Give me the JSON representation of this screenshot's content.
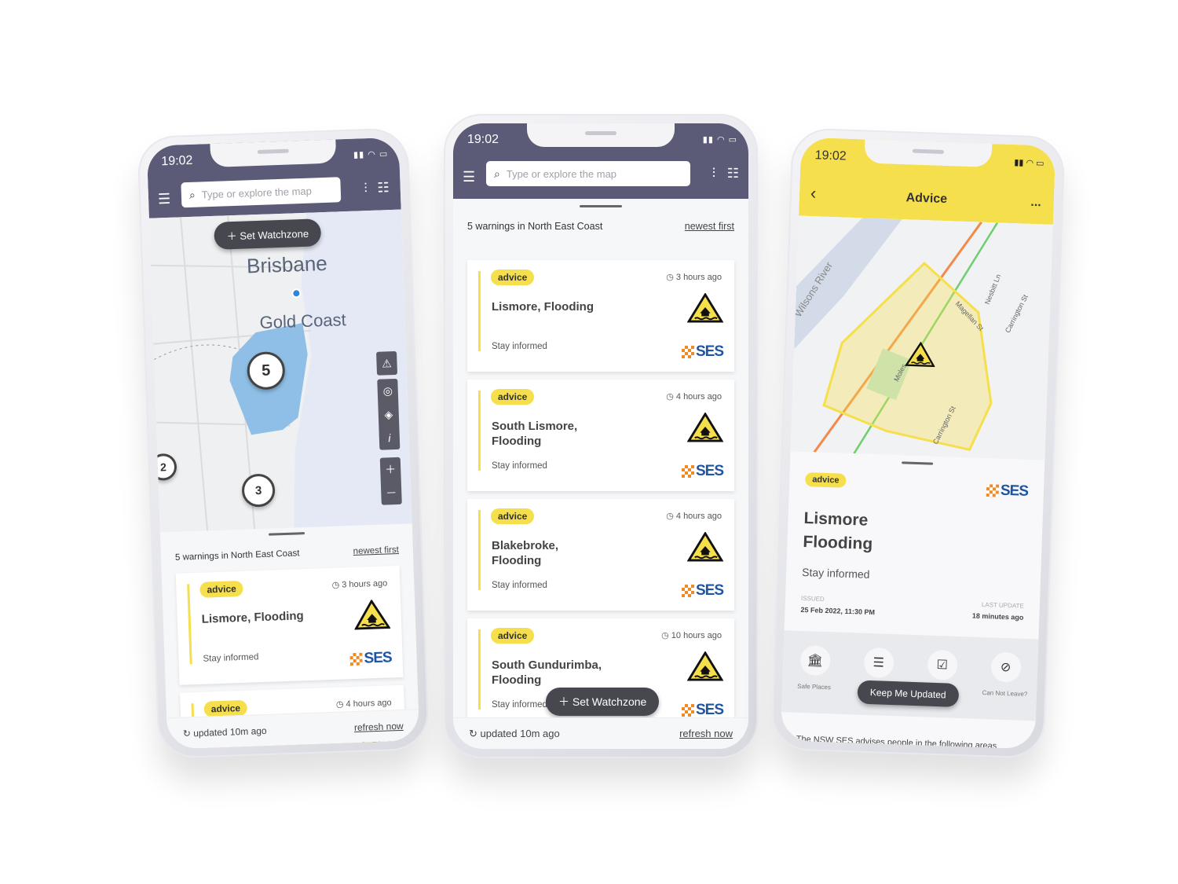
{
  "colors": {
    "header": "#5b5b78",
    "advice": "#f5df4d",
    "ses_blue": "#1e55a3",
    "ses_orange": "#f08a24",
    "warning_area": "#8fbfe6"
  },
  "status_bar": {
    "time": "19:02"
  },
  "search": {
    "placeholder": "Type or explore the map"
  },
  "icons": {
    "menu": "hamburger-icon",
    "search": "search-icon",
    "filter": "sliders-icon",
    "list": "list-icon",
    "clock": "clock-icon",
    "warning": "flood-warning-triangle-icon",
    "refresh": "refresh-icon"
  },
  "map_view": {
    "set_watchzone": "Set Watchzone",
    "labels": {
      "city1": "Brisbane",
      "city2": "Gold Coast"
    },
    "clusters": [
      "5",
      "2",
      "3"
    ],
    "controls": [
      "add-warning",
      "locate",
      "layers",
      "info",
      "zoom-in",
      "zoom-out"
    ]
  },
  "list": {
    "summary": "5 warnings in North East Coast",
    "sort": "newest first"
  },
  "warnings": [
    {
      "level": "advice",
      "ago": "3 hours ago",
      "title": "Lismore, Flooding",
      "action": "Stay informed"
    },
    {
      "level": "advice",
      "ago": "4 hours ago",
      "title": "South Lismore, Flooding",
      "action": "Stay informed"
    },
    {
      "level": "advice",
      "ago": "4 hours ago",
      "title": "Blakebroke, Flooding",
      "action": "Stay informed"
    },
    {
      "level": "advice",
      "ago": "10 hours ago",
      "title": "South Gundurimba, Flooding",
      "action": "Stay informed"
    }
  ],
  "ses_logo": "SES",
  "footer": {
    "updated": "updated 10m ago",
    "refresh": "refresh now"
  },
  "detail": {
    "title": "Advice",
    "more": "...",
    "streets": {
      "river": "Wilsons River",
      "s1": "Nesbitt Ln",
      "s2": "Magellan St",
      "s3": "Carrington St",
      "s4": "Moles",
      "s5": "Carrington St"
    },
    "level": "advice",
    "heading_line1": "Lismore",
    "heading_line2": "Flooding",
    "action": "Stay informed",
    "issued_label": "ISSUED",
    "issued": "25 Feb 2022, 11:30 PM",
    "updated_label": "LAST UPDATE",
    "updated": "18 minutes ago",
    "actions": [
      {
        "label": "Safe Places",
        "icon": "bank-icon"
      },
      {
        "label": "",
        "icon": "list-icon"
      },
      {
        "label": "",
        "icon": "checkbox-icon"
      },
      {
        "label": "Can Not Leave?",
        "icon": "no-walking-icon"
      }
    ],
    "keep_updated": "Keep Me Updated",
    "body": "The NSW SES advises people in the following areas"
  }
}
